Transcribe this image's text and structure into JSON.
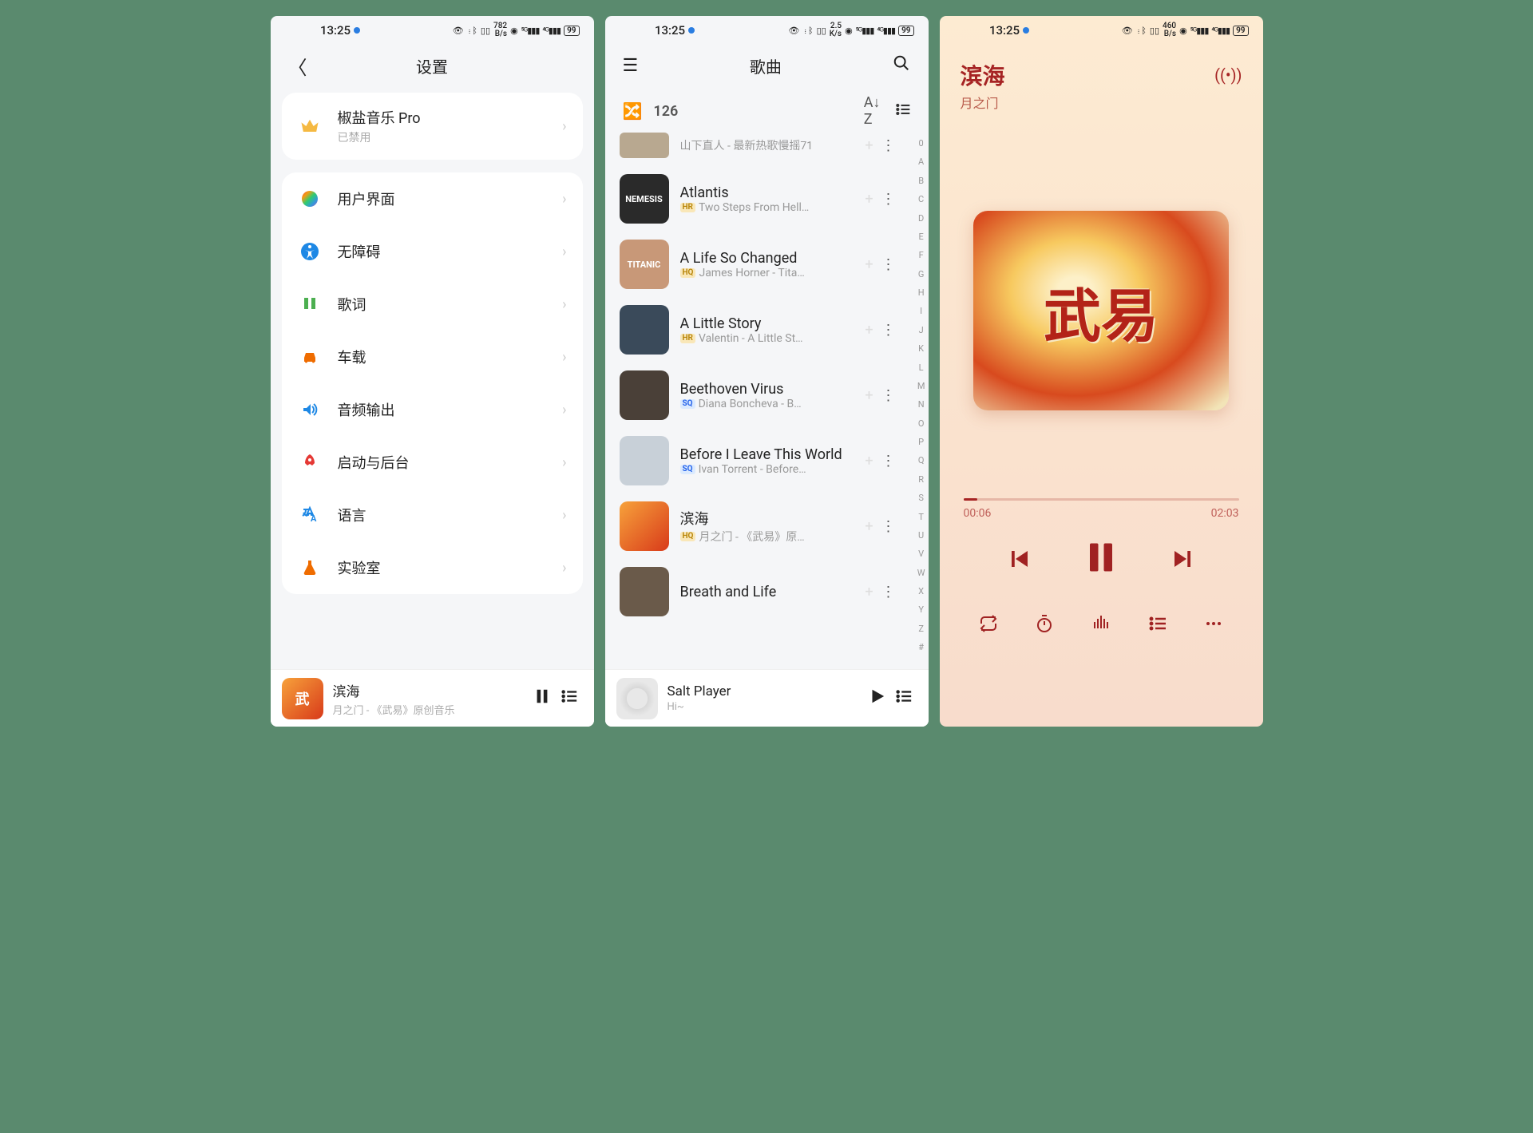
{
  "status": {
    "time": "13:25",
    "bps1": "782",
    "bps2": "2.5",
    "bps3": "460",
    "bps_unit": "B/s",
    "bps_unit_k": "K/s",
    "battery": "99"
  },
  "screen1": {
    "header_title": "设置",
    "pro_card": {
      "title": "椒盐音乐 Pro",
      "sub": "已禁用"
    },
    "items": [
      {
        "icon": "palette",
        "label": "用户界面"
      },
      {
        "icon": "accessibility",
        "label": "无障碍"
      },
      {
        "icon": "lyrics",
        "label": "歌词"
      },
      {
        "icon": "car",
        "label": "车载"
      },
      {
        "icon": "audio",
        "label": "音频输出"
      },
      {
        "icon": "rocket",
        "label": "启动与后台"
      },
      {
        "icon": "language",
        "label": "语言"
      },
      {
        "icon": "lab",
        "label": "实验室"
      }
    ],
    "mini": {
      "title": "滨海",
      "sub": "月之门 - 《武易》原创音乐"
    }
  },
  "screen2": {
    "header_title": "歌曲",
    "count": "126",
    "alpha": [
      "0",
      "A",
      "B",
      "C",
      "D",
      "E",
      "F",
      "G",
      "H",
      "I",
      "J",
      "K",
      "L",
      "M",
      "N",
      "O",
      "P",
      "Q",
      "R",
      "S",
      "T",
      "U",
      "V",
      "W",
      "X",
      "Y",
      "Z",
      "#"
    ],
    "songs": [
      {
        "title": "",
        "sub": "山下直人 - 最新热歌慢摇71",
        "badge": "",
        "art": "#b8a890"
      },
      {
        "title": "Atlantis",
        "sub": "Two Steps From Hell…",
        "badge": "HR",
        "art": "#2a2a2a",
        "art_text": "NEMESIS"
      },
      {
        "title": "A Life So Changed",
        "sub": "James Horner - Tita…",
        "badge": "HQ",
        "art": "#c89878",
        "art_text": "TITANIC"
      },
      {
        "title": "A Little Story",
        "sub": "Valentin - A Little St…",
        "badge": "HR",
        "art": "#3a4a5a"
      },
      {
        "title": "Beethoven Virus",
        "sub": "Diana Boncheva - B…",
        "badge": "SQ",
        "art": "#4a4038"
      },
      {
        "title": "Before I Leave This World",
        "sub": "Ivan Torrent - Before…",
        "badge": "SQ",
        "art": "#c8d0d8"
      },
      {
        "title": "滨海",
        "sub": "月之门 - 《武易》原…",
        "badge": "HQ",
        "art": "gradient"
      },
      {
        "title": "Breath and Life",
        "sub": "",
        "badge": "",
        "art": "#6a5a4a"
      }
    ],
    "mini": {
      "title": "Salt Player",
      "sub": "Hi~"
    }
  },
  "screen3": {
    "title": "滨海",
    "artist": "月之门",
    "art_text": "武易",
    "elapsed": "00:06",
    "duration": "02:03",
    "progress_pct": 5
  }
}
